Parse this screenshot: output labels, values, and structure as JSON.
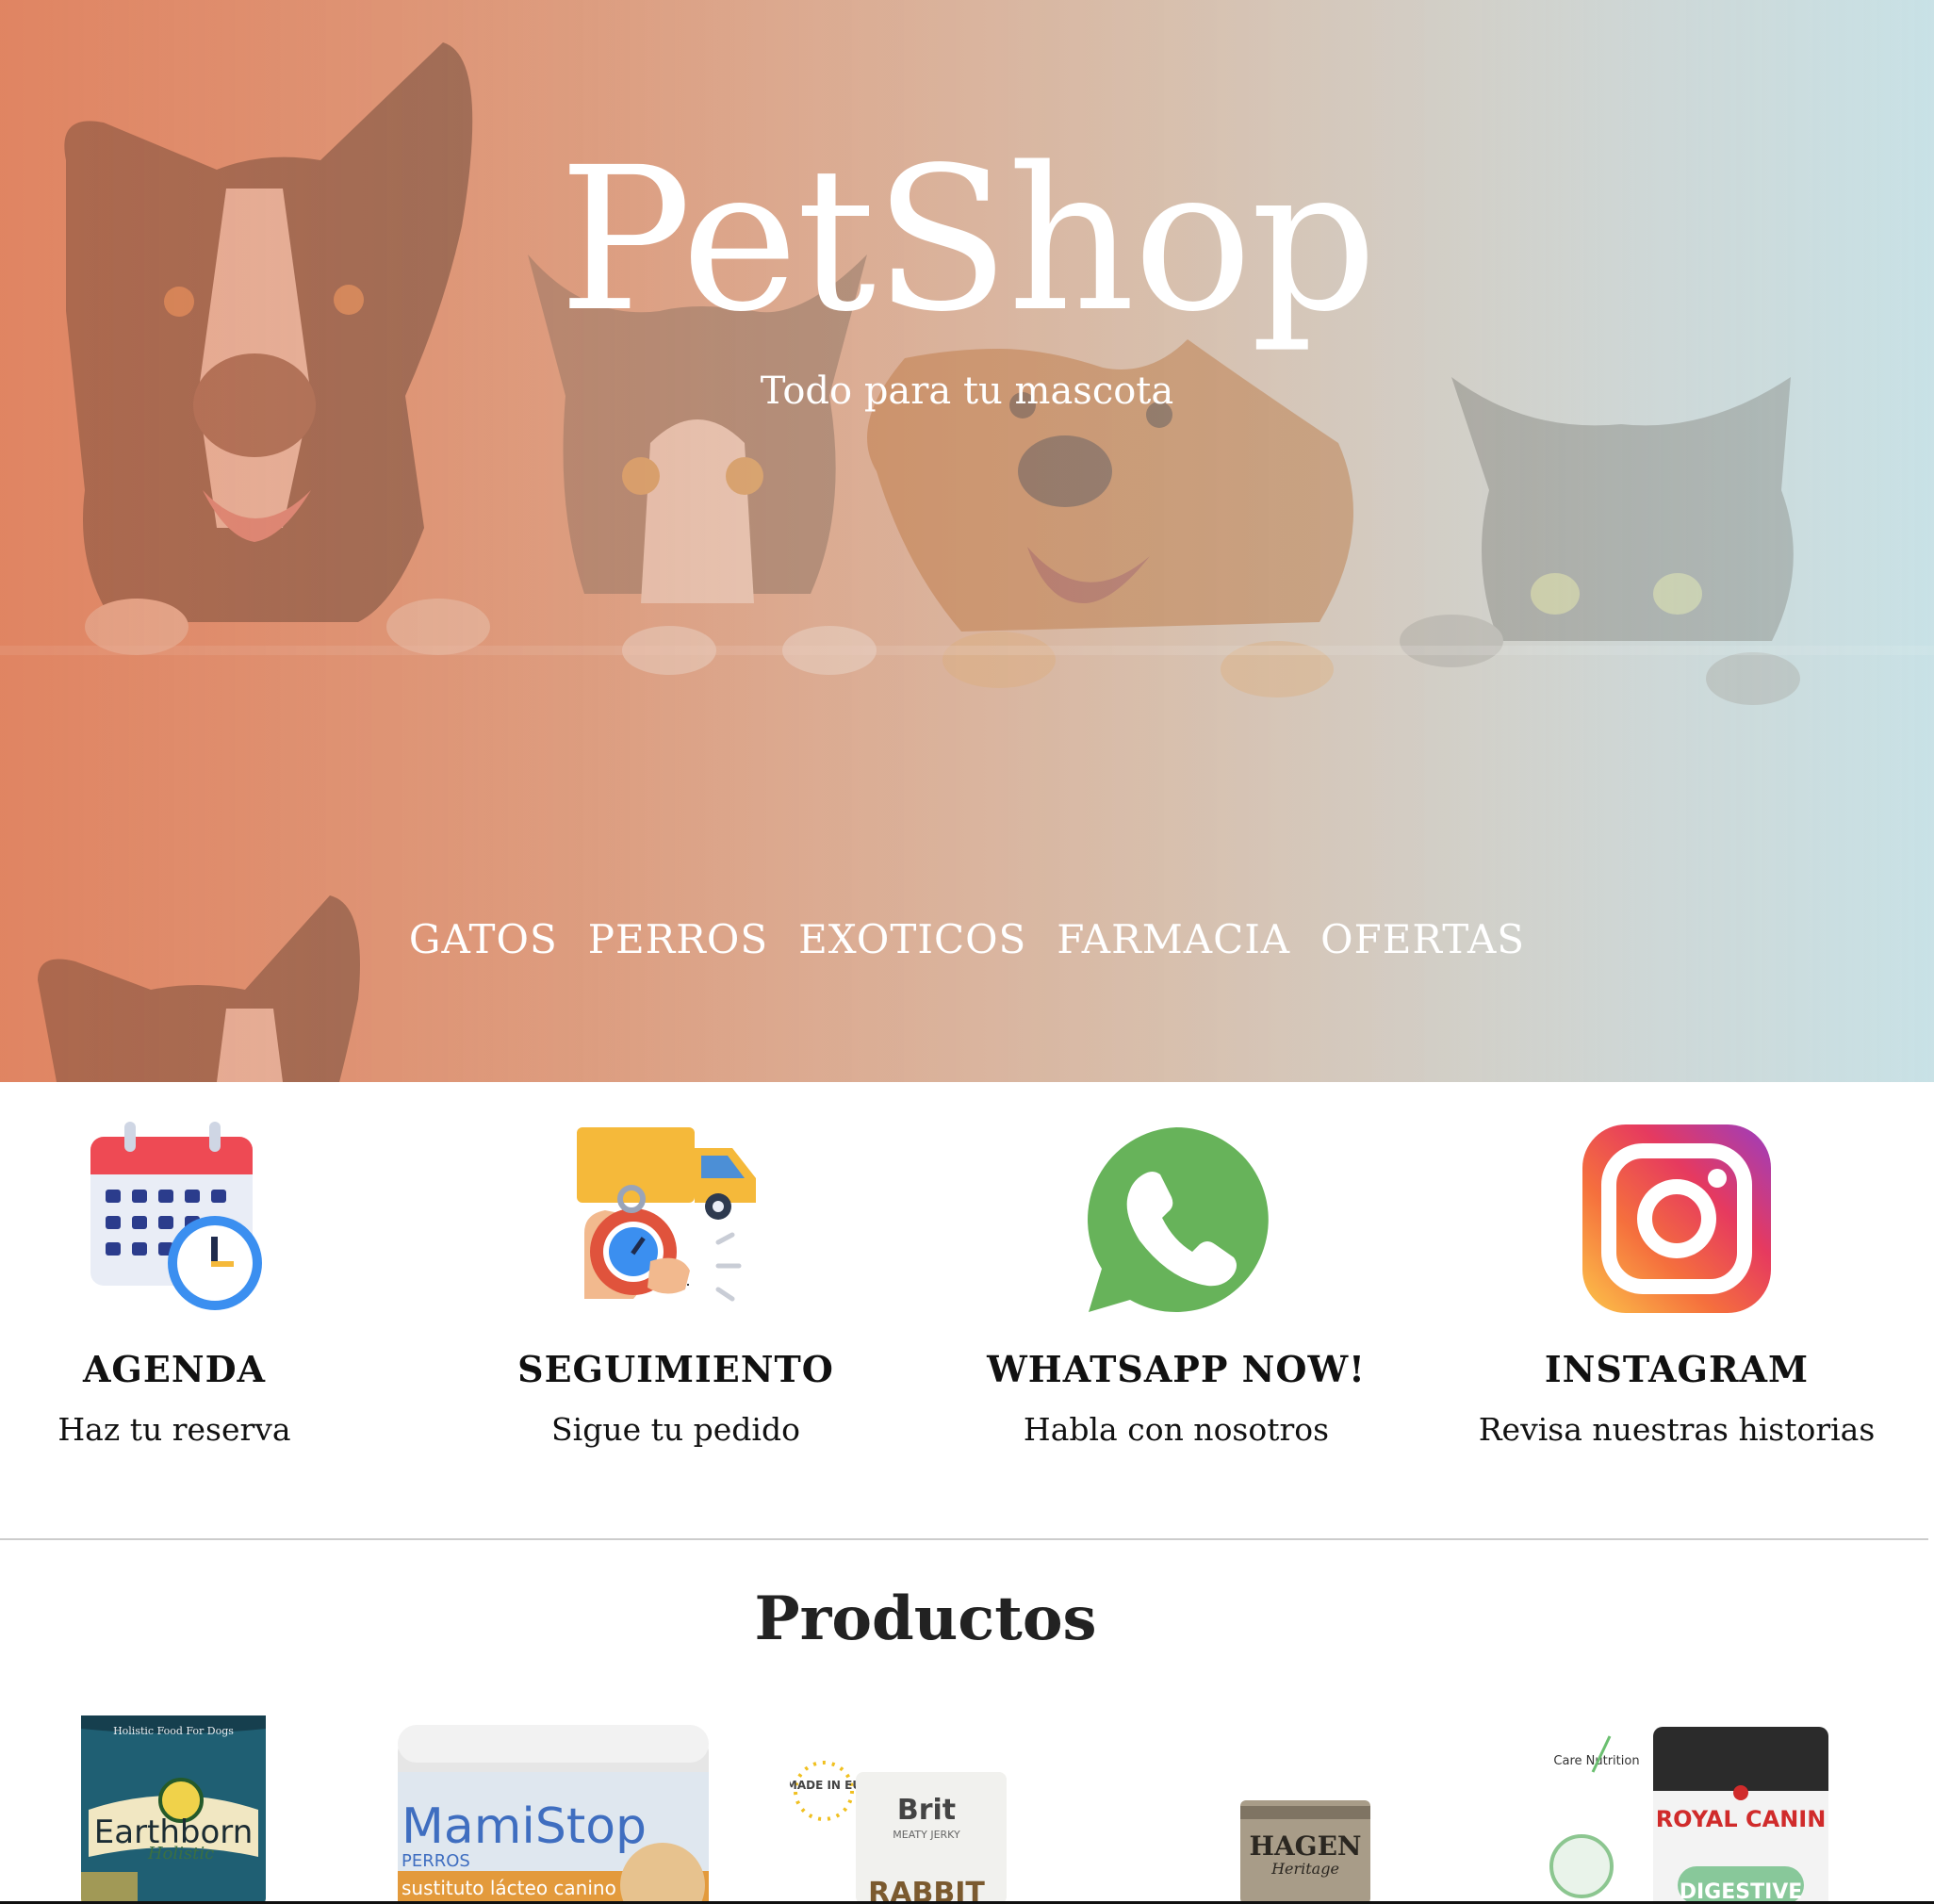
{
  "hero": {
    "title": "PetShop",
    "subtitle": "Todo para tu mascota"
  },
  "nav": {
    "items": [
      "GATOS",
      "PERROS",
      "EXOTICOS",
      "FARMACIA",
      "OFERTAS"
    ]
  },
  "features": [
    {
      "icon": "calendar-clock-icon",
      "title": "AGENDA",
      "desc": "Haz tu reserva"
    },
    {
      "icon": "delivery-truck-stopwatch-icon",
      "title": "SEGUIMIENTO",
      "desc": "Sigue tu pedido"
    },
    {
      "icon": "whatsapp-icon",
      "title": "WHATSAPP NOW!",
      "desc": "Habla con nosotros"
    },
    {
      "icon": "instagram-icon",
      "title": "INSTAGRAM",
      "desc": "Revisa nuestras historias"
    }
  ],
  "products": {
    "title": "Productos",
    "items": [
      {
        "brand": "Earthborn",
        "subtitle": "Holistic",
        "tagline": "Holistic Food For Dogs"
      },
      {
        "brand": "MamiStop",
        "subtitle": "PERROS",
        "tagline": "sustituto lácteo canino"
      },
      {
        "brand": "Brit",
        "subtitle": "RABBIT",
        "tagline": "MEATY JERKY",
        "badge": "MADE IN EU"
      },
      {
        "brand": "HAGEN",
        "subtitle": "Heritage"
      },
      {
        "brand": "ROYAL CANIN",
        "subtitle": "DIGESTIVE",
        "tagline": "Care Nutrition"
      }
    ]
  },
  "colors": {
    "hero_left": "#e0896a",
    "hero_right": "#c9e2e6",
    "whatsapp": "#67b35a",
    "calendar_red": "#ee4a54",
    "truck_yellow": "#f5b93a"
  }
}
